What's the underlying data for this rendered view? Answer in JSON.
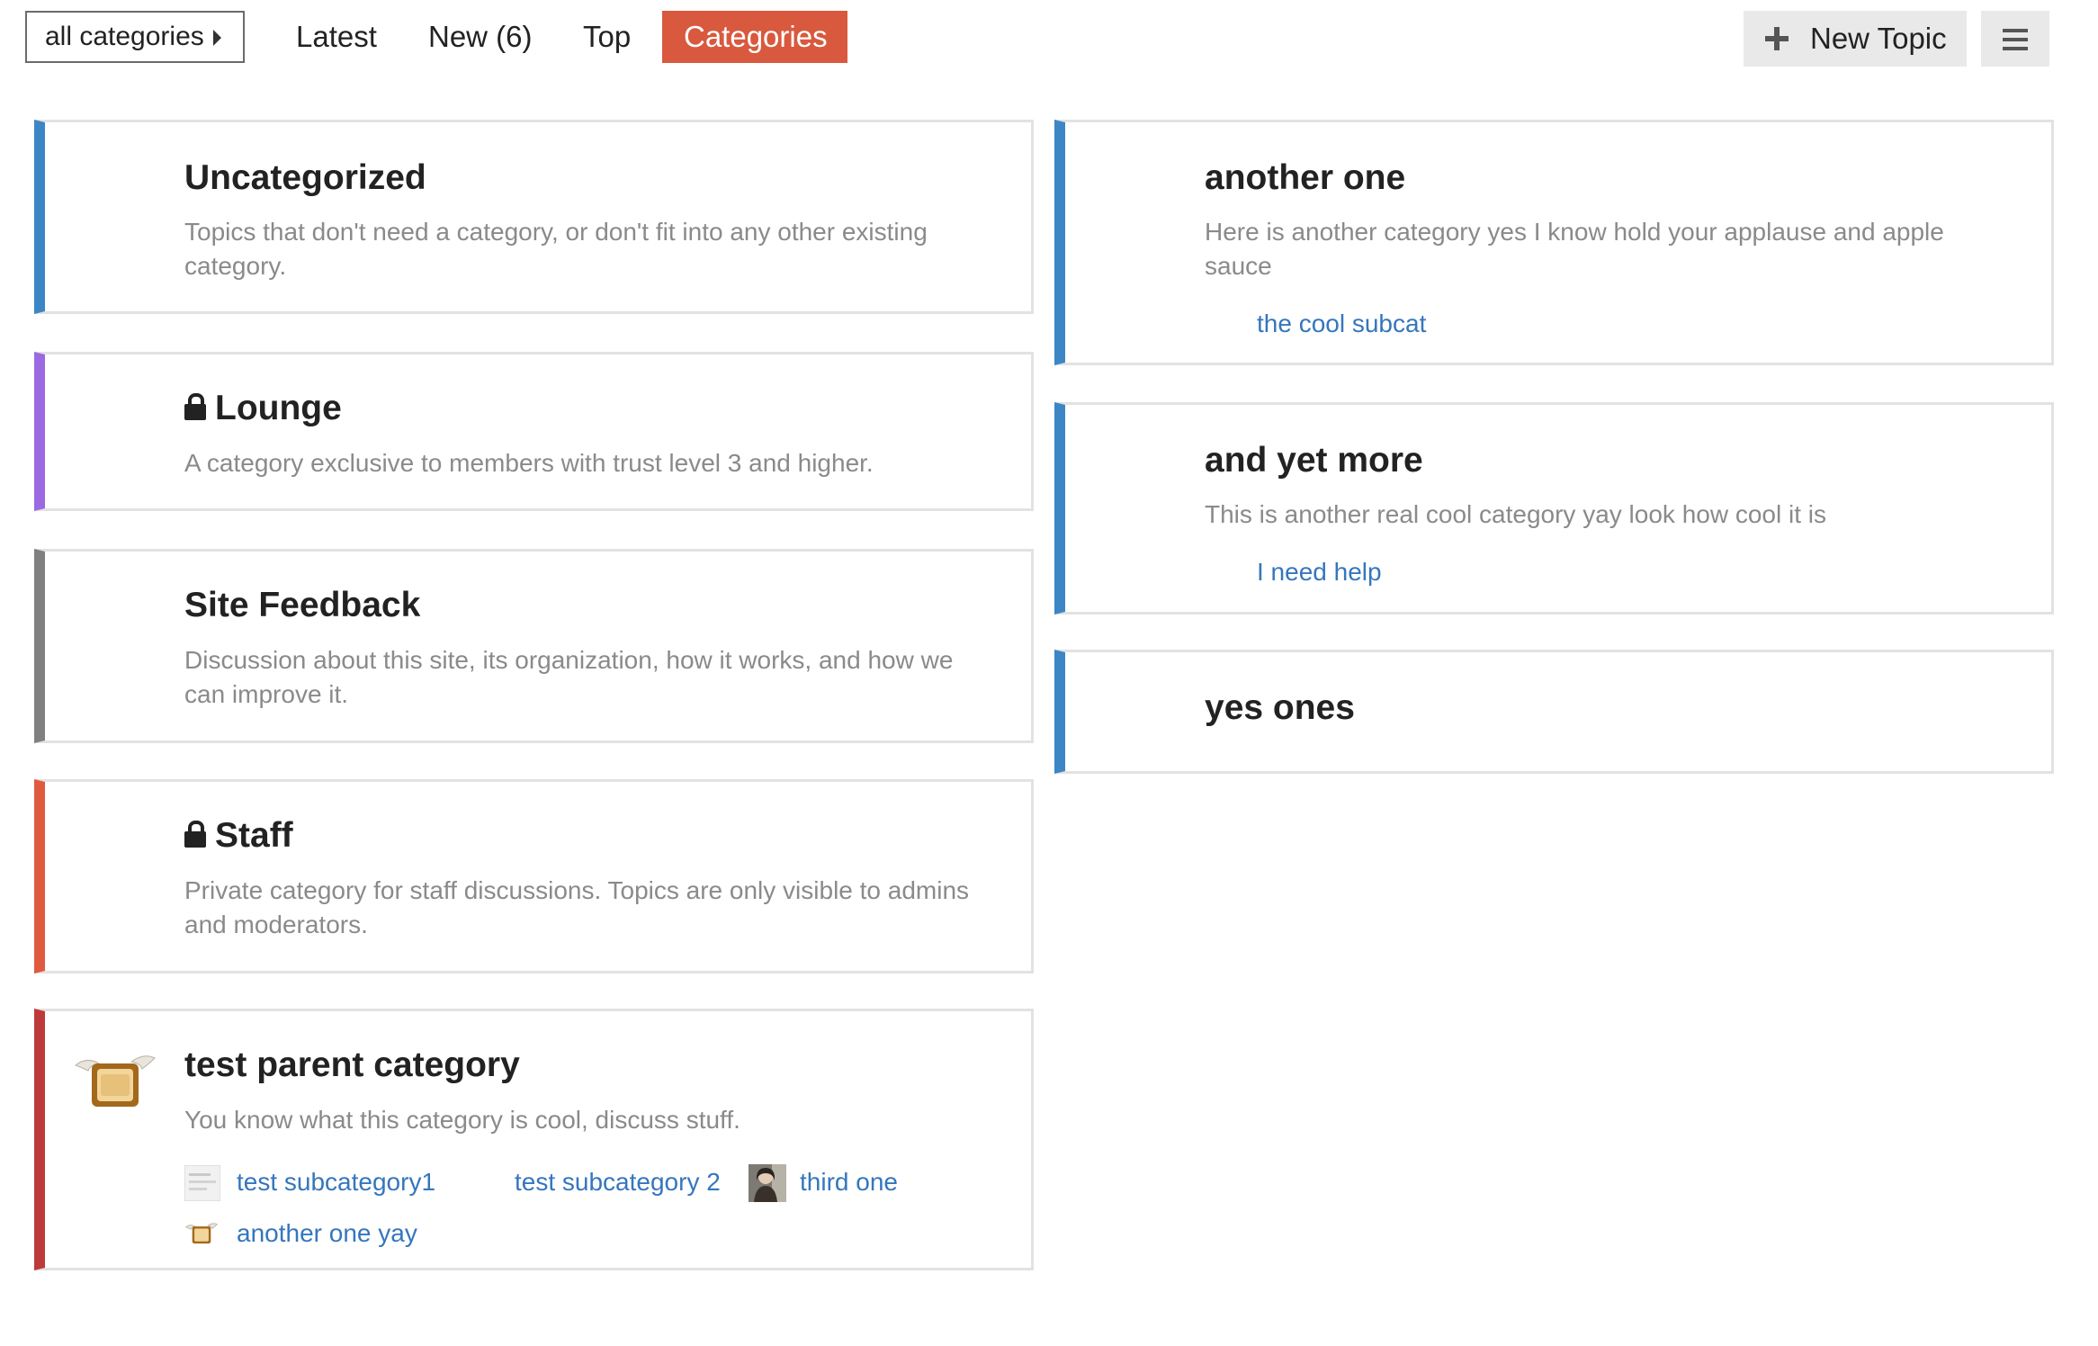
{
  "nav": {
    "category_dropdown": "all categories",
    "tabs": [
      {
        "label": "Latest"
      },
      {
        "label": "New (6)"
      },
      {
        "label": "Top"
      },
      {
        "label": "Categories",
        "active": true
      }
    ],
    "new_topic_label": "New Topic",
    "menu_icon": "hamburger-icon"
  },
  "colors": {
    "active_tab": "#d8593e",
    "uncategorized": "#3c86c6",
    "lounge": "#9b6ae1",
    "site_feedback": "#808080",
    "staff": "#e05a3f",
    "test_parent": "#be3a3a",
    "link": "#3576bd"
  },
  "categories_left": [
    {
      "title": "Uncategorized",
      "description": "Topics that don't need a category, or don't fit into any other existing category."
    },
    {
      "title": "Lounge",
      "locked": true,
      "description": "A category exclusive to members with trust level 3 and higher."
    },
    {
      "title": "Site Feedback",
      "description": "Discussion about this site, its organization, how it works, and how we can improve it."
    },
    {
      "title": "Staff",
      "locked": true,
      "description": "Private category for staff discussions. Topics are only visible to admins and moderators."
    },
    {
      "title": "test parent category",
      "description": "You know what this category is cool, discuss stuff.",
      "subcategories": [
        {
          "label": "test subcategory1"
        },
        {
          "label": "test subcategory 2"
        },
        {
          "label": "third one"
        },
        {
          "label": "another one yay"
        }
      ]
    }
  ],
  "categories_right": [
    {
      "title": "another one",
      "description": "Here is another category yes I know hold your applause and apple sauce",
      "subcategories": [
        {
          "label": "the cool subcat"
        }
      ]
    },
    {
      "title": "and yet more",
      "description": "This is another real cool category yay look how cool it is",
      "subcategories": [
        {
          "label": "I need help"
        }
      ]
    },
    {
      "title": "yes ones"
    }
  ]
}
